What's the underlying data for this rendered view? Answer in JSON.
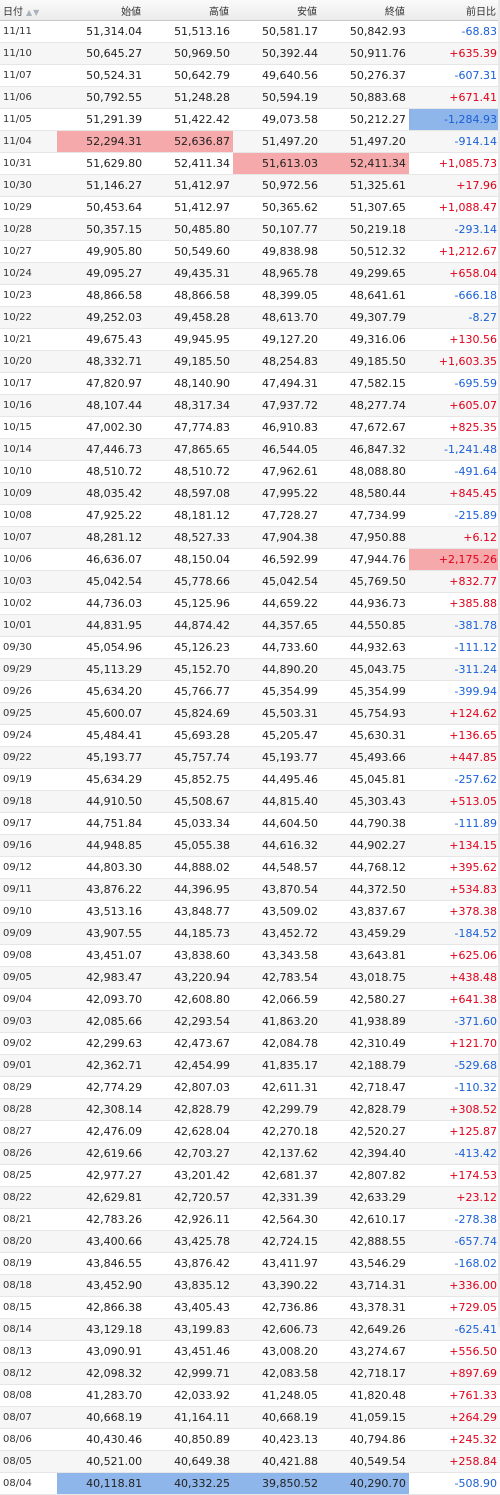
{
  "header": {
    "date": "日付",
    "open": "始値",
    "high": "高値",
    "low": "安値",
    "close": "終値",
    "change": "前日比",
    "sort_icon": "sort-arrows-icon"
  },
  "colors": {
    "up": "#e0001a",
    "down": "#1a5fd6",
    "highlight_high": "#f6a9ab",
    "highlight_low": "#8fb6ea"
  },
  "rows": [
    {
      "date": "11/11",
      "open": "51,314.04",
      "high": "51,513.16",
      "low": "50,581.17",
      "close": "50,842.93",
      "change": "-68.83"
    },
    {
      "date": "11/10",
      "open": "50,645.27",
      "high": "50,969.50",
      "low": "50,392.44",
      "close": "50,911.76",
      "change": "+635.39"
    },
    {
      "date": "11/07",
      "open": "50,524.31",
      "high": "50,642.79",
      "low": "49,640.56",
      "close": "50,276.37",
      "change": "-607.31"
    },
    {
      "date": "11/06",
      "open": "50,792.55",
      "high": "51,248.28",
      "low": "50,594.19",
      "close": "50,883.68",
      "change": "+671.41"
    },
    {
      "date": "11/05",
      "open": "51,291.39",
      "high": "51,422.42",
      "low": "49,073.58",
      "close": "50,212.27",
      "change": "-1,284.93",
      "hl": {
        "change": "blue"
      }
    },
    {
      "date": "11/04",
      "open": "52,294.31",
      "high": "52,636.87",
      "low": "51,497.20",
      "close": "51,497.20",
      "change": "-914.14",
      "hl": {
        "open": "red",
        "high": "red"
      }
    },
    {
      "date": "10/31",
      "open": "51,629.80",
      "high": "52,411.34",
      "low": "51,613.03",
      "close": "52,411.34",
      "change": "+1,085.73",
      "hl": {
        "low": "red",
        "close": "red"
      }
    },
    {
      "date": "10/30",
      "open": "51,146.27",
      "high": "51,412.97",
      "low": "50,972.56",
      "close": "51,325.61",
      "change": "+17.96"
    },
    {
      "date": "10/29",
      "open": "50,453.64",
      "high": "51,412.97",
      "low": "50,365.62",
      "close": "51,307.65",
      "change": "+1,088.47"
    },
    {
      "date": "10/28",
      "open": "50,357.15",
      "high": "50,485.80",
      "low": "50,107.77",
      "close": "50,219.18",
      "change": "-293.14"
    },
    {
      "date": "10/27",
      "open": "49,905.80",
      "high": "50,549.60",
      "low": "49,838.98",
      "close": "50,512.32",
      "change": "+1,212.67"
    },
    {
      "date": "10/24",
      "open": "49,095.27",
      "high": "49,435.31",
      "low": "48,965.78",
      "close": "49,299.65",
      "change": "+658.04"
    },
    {
      "date": "10/23",
      "open": "48,866.58",
      "high": "48,866.58",
      "low": "48,399.05",
      "close": "48,641.61",
      "change": "-666.18"
    },
    {
      "date": "10/22",
      "open": "49,252.03",
      "high": "49,458.28",
      "low": "48,613.70",
      "close": "49,307.79",
      "change": "-8.27"
    },
    {
      "date": "10/21",
      "open": "49,675.43",
      "high": "49,945.95",
      "low": "49,127.20",
      "close": "49,316.06",
      "change": "+130.56"
    },
    {
      "date": "10/20",
      "open": "48,332.71",
      "high": "49,185.50",
      "low": "48,254.83",
      "close": "49,185.50",
      "change": "+1,603.35"
    },
    {
      "date": "10/17",
      "open": "47,820.97",
      "high": "48,140.90",
      "low": "47,494.31",
      "close": "47,582.15",
      "change": "-695.59"
    },
    {
      "date": "10/16",
      "open": "48,107.44",
      "high": "48,317.34",
      "low": "47,937.72",
      "close": "48,277.74",
      "change": "+605.07"
    },
    {
      "date": "10/15",
      "open": "47,002.30",
      "high": "47,774.83",
      "low": "46,910.83",
      "close": "47,672.67",
      "change": "+825.35"
    },
    {
      "date": "10/14",
      "open": "47,446.73",
      "high": "47,865.65",
      "low": "46,544.05",
      "close": "46,847.32",
      "change": "-1,241.48"
    },
    {
      "date": "10/10",
      "open": "48,510.72",
      "high": "48,510.72",
      "low": "47,962.61",
      "close": "48,088.80",
      "change": "-491.64"
    },
    {
      "date": "10/09",
      "open": "48,035.42",
      "high": "48,597.08",
      "low": "47,995.22",
      "close": "48,580.44",
      "change": "+845.45"
    },
    {
      "date": "10/08",
      "open": "47,925.22",
      "high": "48,181.12",
      "low": "47,728.27",
      "close": "47,734.99",
      "change": "-215.89"
    },
    {
      "date": "10/07",
      "open": "48,281.12",
      "high": "48,527.33",
      "low": "47,904.38",
      "close": "47,950.88",
      "change": "+6.12"
    },
    {
      "date": "10/06",
      "open": "46,636.07",
      "high": "48,150.04",
      "low": "46,592.99",
      "close": "47,944.76",
      "change": "+2,175.26",
      "hl": {
        "change": "red"
      }
    },
    {
      "date": "10/03",
      "open": "45,042.54",
      "high": "45,778.66",
      "low": "45,042.54",
      "close": "45,769.50",
      "change": "+832.77"
    },
    {
      "date": "10/02",
      "open": "44,736.03",
      "high": "45,125.96",
      "low": "44,659.22",
      "close": "44,936.73",
      "change": "+385.88"
    },
    {
      "date": "10/01",
      "open": "44,831.95",
      "high": "44,874.42",
      "low": "44,357.65",
      "close": "44,550.85",
      "change": "-381.78"
    },
    {
      "date": "09/30",
      "open": "45,054.96",
      "high": "45,126.23",
      "low": "44,733.60",
      "close": "44,932.63",
      "change": "-111.12"
    },
    {
      "date": "09/29",
      "open": "45,113.29",
      "high": "45,152.70",
      "low": "44,890.20",
      "close": "45,043.75",
      "change": "-311.24"
    },
    {
      "date": "09/26",
      "open": "45,634.20",
      "high": "45,766.77",
      "low": "45,354.99",
      "close": "45,354.99",
      "change": "-399.94"
    },
    {
      "date": "09/25",
      "open": "45,600.07",
      "high": "45,824.69",
      "low": "45,503.31",
      "close": "45,754.93",
      "change": "+124.62"
    },
    {
      "date": "09/24",
      "open": "45,484.41",
      "high": "45,693.28",
      "low": "45,205.47",
      "close": "45,630.31",
      "change": "+136.65"
    },
    {
      "date": "09/22",
      "open": "45,193.77",
      "high": "45,757.74",
      "low": "45,193.77",
      "close": "45,493.66",
      "change": "+447.85"
    },
    {
      "date": "09/19",
      "open": "45,634.29",
      "high": "45,852.75",
      "low": "44,495.46",
      "close": "45,045.81",
      "change": "-257.62"
    },
    {
      "date": "09/18",
      "open": "44,910.50",
      "high": "45,508.67",
      "low": "44,815.40",
      "close": "45,303.43",
      "change": "+513.05"
    },
    {
      "date": "09/17",
      "open": "44,751.84",
      "high": "45,033.34",
      "low": "44,604.50",
      "close": "44,790.38",
      "change": "-111.89"
    },
    {
      "date": "09/16",
      "open": "44,948.85",
      "high": "45,055.38",
      "low": "44,616.32",
      "close": "44,902.27",
      "change": "+134.15"
    },
    {
      "date": "09/12",
      "open": "44,803.30",
      "high": "44,888.02",
      "low": "44,548.57",
      "close": "44,768.12",
      "change": "+395.62"
    },
    {
      "date": "09/11",
      "open": "43,876.22",
      "high": "44,396.95",
      "low": "43,870.54",
      "close": "44,372.50",
      "change": "+534.83"
    },
    {
      "date": "09/10",
      "open": "43,513.16",
      "high": "43,848.77",
      "low": "43,509.02",
      "close": "43,837.67",
      "change": "+378.38"
    },
    {
      "date": "09/09",
      "open": "43,907.55",
      "high": "44,185.73",
      "low": "43,452.72",
      "close": "43,459.29",
      "change": "-184.52"
    },
    {
      "date": "09/08",
      "open": "43,451.07",
      "high": "43,838.60",
      "low": "43,343.58",
      "close": "43,643.81",
      "change": "+625.06"
    },
    {
      "date": "09/05",
      "open": "42,983.47",
      "high": "43,220.94",
      "low": "42,783.54",
      "close": "43,018.75",
      "change": "+438.48"
    },
    {
      "date": "09/04",
      "open": "42,093.70",
      "high": "42,608.80",
      "low": "42,066.59",
      "close": "42,580.27",
      "change": "+641.38"
    },
    {
      "date": "09/03",
      "open": "42,085.66",
      "high": "42,293.54",
      "low": "41,863.20",
      "close": "41,938.89",
      "change": "-371.60"
    },
    {
      "date": "09/02",
      "open": "42,299.63",
      "high": "42,473.67",
      "low": "42,084.78",
      "close": "42,310.49",
      "change": "+121.70"
    },
    {
      "date": "09/01",
      "open": "42,362.71",
      "high": "42,454.99",
      "low": "41,835.17",
      "close": "42,188.79",
      "change": "-529.68"
    },
    {
      "date": "08/29",
      "open": "42,774.29",
      "high": "42,807.03",
      "low": "42,611.31",
      "close": "42,718.47",
      "change": "-110.32"
    },
    {
      "date": "08/28",
      "open": "42,308.14",
      "high": "42,828.79",
      "low": "42,299.79",
      "close": "42,828.79",
      "change": "+308.52"
    },
    {
      "date": "08/27",
      "open": "42,476.09",
      "high": "42,628.04",
      "low": "42,270.18",
      "close": "42,520.27",
      "change": "+125.87"
    },
    {
      "date": "08/26",
      "open": "42,619.66",
      "high": "42,703.27",
      "low": "42,137.62",
      "close": "42,394.40",
      "change": "-413.42"
    },
    {
      "date": "08/25",
      "open": "42,977.27",
      "high": "43,201.42",
      "low": "42,681.37",
      "close": "42,807.82",
      "change": "+174.53"
    },
    {
      "date": "08/22",
      "open": "42,629.81",
      "high": "42,720.57",
      "low": "42,331.39",
      "close": "42,633.29",
      "change": "+23.12"
    },
    {
      "date": "08/21",
      "open": "42,783.26",
      "high": "42,926.11",
      "low": "42,564.30",
      "close": "42,610.17",
      "change": "-278.38"
    },
    {
      "date": "08/20",
      "open": "43,400.66",
      "high": "43,425.78",
      "low": "42,724.15",
      "close": "42,888.55",
      "change": "-657.74"
    },
    {
      "date": "08/19",
      "open": "43,846.55",
      "high": "43,876.42",
      "low": "43,411.97",
      "close": "43,546.29",
      "change": "-168.02"
    },
    {
      "date": "08/18",
      "open": "43,452.90",
      "high": "43,835.12",
      "low": "43,390.22",
      "close": "43,714.31",
      "change": "+336.00"
    },
    {
      "date": "08/15",
      "open": "42,866.38",
      "high": "43,405.43",
      "low": "42,736.86",
      "close": "43,378.31",
      "change": "+729.05"
    },
    {
      "date": "08/14",
      "open": "43,129.18",
      "high": "43,199.83",
      "low": "42,606.73",
      "close": "42,649.26",
      "change": "-625.41"
    },
    {
      "date": "08/13",
      "open": "43,090.91",
      "high": "43,451.46",
      "low": "43,008.20",
      "close": "43,274.67",
      "change": "+556.50"
    },
    {
      "date": "08/12",
      "open": "42,098.32",
      "high": "42,999.71",
      "low": "42,083.58",
      "close": "42,718.17",
      "change": "+897.69"
    },
    {
      "date": "08/08",
      "open": "41,283.70",
      "high": "42,033.92",
      "low": "41,248.05",
      "close": "41,820.48",
      "change": "+761.33"
    },
    {
      "date": "08/07",
      "open": "40,668.19",
      "high": "41,164.11",
      "low": "40,668.19",
      "close": "41,059.15",
      "change": "+264.29"
    },
    {
      "date": "08/06",
      "open": "40,430.46",
      "high": "40,850.89",
      "low": "40,423.13",
      "close": "40,794.86",
      "change": "+245.32"
    },
    {
      "date": "08/05",
      "open": "40,521.00",
      "high": "40,649.38",
      "low": "40,421.88",
      "close": "40,549.54",
      "change": "+258.84"
    },
    {
      "date": "08/04",
      "open": "40,118.81",
      "high": "40,332.25",
      "low": "39,850.52",
      "close": "40,290.70",
      "change": "-508.90",
      "hl": {
        "open": "blue",
        "high": "blue",
        "low": "blue",
        "close": "blue"
      }
    }
  ]
}
